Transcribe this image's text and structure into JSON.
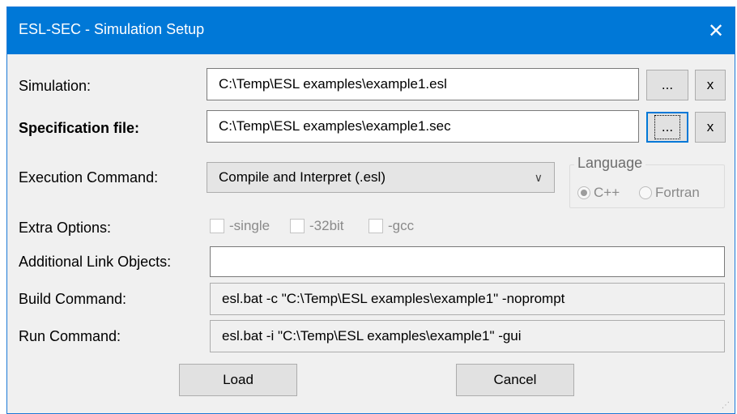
{
  "window": {
    "title": "ESL-SEC - Simulation Setup",
    "close_label": "✕"
  },
  "labels": {
    "simulation": "Simulation:",
    "specification_file": "Specification file:",
    "execution_command": "Execution Command:",
    "extra_options": "Extra Options:",
    "additional_link_objects": "Additional Link Objects:",
    "build_command": "Build Command:",
    "run_command": "Run Command:"
  },
  "fields": {
    "simulation_value": "C:\\Temp\\ESL examples\\example1.esl",
    "specification_value": "C:\\Temp\\ESL examples\\example1.sec",
    "execution_selected": "Compile and Interpret (.esl)",
    "additional_link_value": "",
    "build_command_value": "esl.bat -c \"C:\\Temp\\ESL examples\\example1\" -noprompt",
    "run_command_value": "esl.bat -i \"C:\\Temp\\ESL examples\\example1\" -gui"
  },
  "buttons": {
    "browse": "...",
    "clear": "x",
    "load": "Load",
    "cancel": "Cancel"
  },
  "language": {
    "title": "Language",
    "options": [
      "C++",
      "Fortran"
    ],
    "selected": "C++"
  },
  "extra_options": [
    "-single",
    "-32bit",
    "-gcc"
  ],
  "icons": {
    "dropdown": "chevron-down-icon",
    "close": "close-icon"
  },
  "colors": {
    "titlebar": "#0078d7",
    "dialog_bg": "#f0f0f0",
    "focus_border": "#0078d7"
  }
}
